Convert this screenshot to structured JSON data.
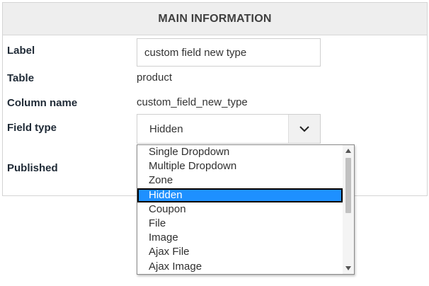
{
  "header": {
    "title": "MAIN INFORMATION"
  },
  "fields": {
    "label": {
      "label": "Label",
      "value": "custom field new type"
    },
    "table": {
      "label": "Table",
      "value": "product"
    },
    "column_name": {
      "label": "Column name",
      "value": "custom_field_new_type"
    },
    "field_type": {
      "label": "Field type",
      "value": "Hidden"
    },
    "published": {
      "label": "Published"
    }
  },
  "dropdown": {
    "options": [
      {
        "label": "Single Dropdown",
        "selected": false
      },
      {
        "label": "Multiple Dropdown",
        "selected": false
      },
      {
        "label": "Zone",
        "selected": false
      },
      {
        "label": "Hidden",
        "selected": true
      },
      {
        "label": "Coupon",
        "selected": false
      },
      {
        "label": "File",
        "selected": false
      },
      {
        "label": "Image",
        "selected": false
      },
      {
        "label": "Ajax File",
        "selected": false
      },
      {
        "label": "Ajax Image",
        "selected": false
      }
    ],
    "scroll_up_icon": "triangle-up-icon",
    "scroll_down_icon": "triangle-down-icon"
  },
  "select_arrow_icon": "chevron-down-icon",
  "colors": {
    "selected_bg": "#1e90ff",
    "header_bg": "#eeeeee",
    "label_text": "#1f2a36"
  }
}
